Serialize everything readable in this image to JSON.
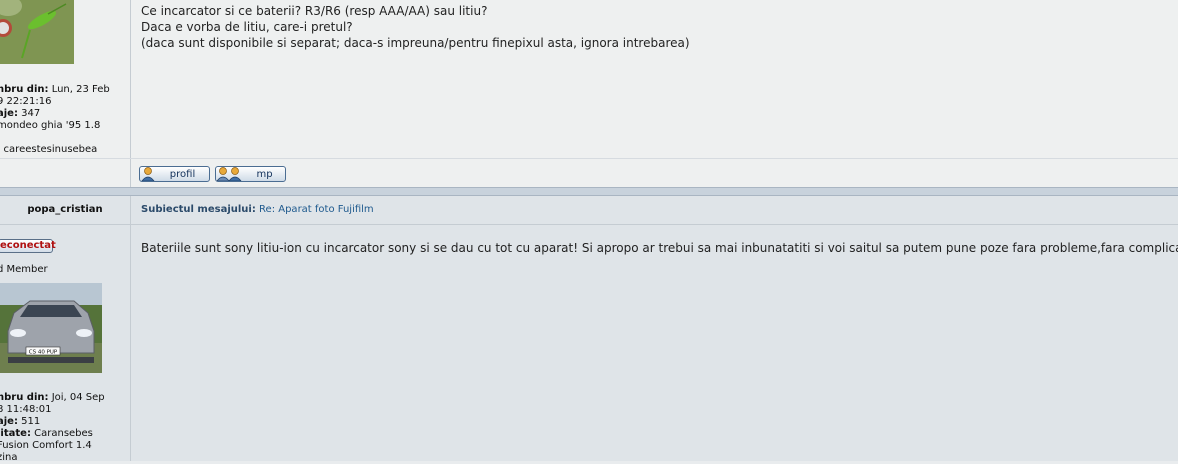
{
  "post1": {
    "message_lines": [
      "Ce incarcator si ce baterii? R3/R6 (resp AAA/AA) sau litiu?",
      "Daca e vorba de litiu, care-i pretul?",
      "(daca sunt disponibile si separat; daca-s impreuna/pentru finepixul asta, ignora intrebarea)"
    ],
    "profile": {
      "member_label": "nbru din:",
      "member_value": " Lun, 23 Feb",
      "member_time": "9 22:21:16",
      "posts_label": "aje:",
      "posts_value": " 347",
      "car": " mondeo ghia '95 1.8",
      "signature": ": careestesinusebea"
    },
    "buttons": {
      "profile": "profil",
      "pm": "mp"
    }
  },
  "post2": {
    "author": "popa_cristian",
    "subject_label": "Subiectul mesajului:",
    "subject_value": "Re: Aparat foto Fujifilm",
    "status": "econectat",
    "rank": "d Member",
    "avatar_plate": "CS 40 PUP",
    "message": "Bateriile sunt sony litiu-ion cu incarcator sony si se dau cu tot cu aparat! Si apropo ar trebui sa mai inbunatatiti si voi saitul sa putem pune poze fara probleme,fara complicatii!",
    "profile": {
      "member_label": "nbru din:",
      "member_value": " Joi, 04 Sep",
      "member_time": "8 11:48:01",
      "posts_label": "aje:",
      "posts_value": " 511",
      "location_label": "litate:",
      "location_value": " Caransebes",
      "car": " Fusion Comfort 1.4",
      "fuel": "zina"
    }
  },
  "colors": {
    "link": "#1f5a8e",
    "subject_label": "#2b4a6a",
    "separator": "#c8d2dc"
  }
}
